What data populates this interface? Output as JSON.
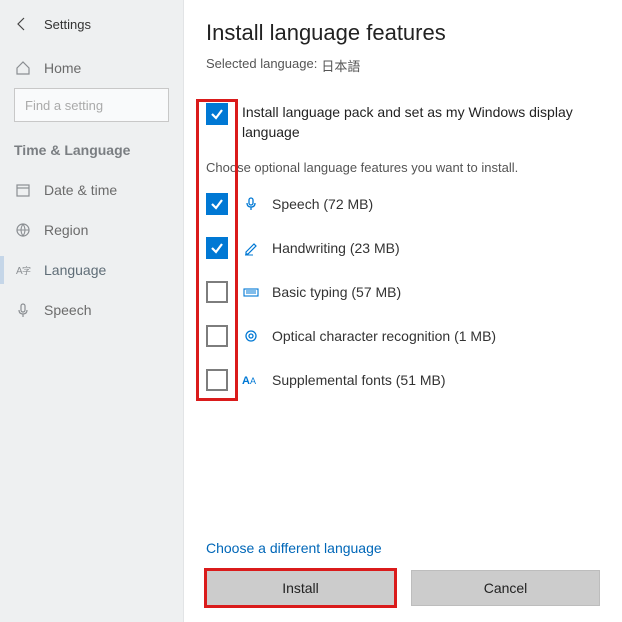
{
  "sidebar": {
    "app_title": "Settings",
    "home_label": "Home",
    "search_placeholder": "Find a setting",
    "category_label": "Time & Language",
    "items": [
      {
        "label": "Date & time"
      },
      {
        "label": "Region"
      },
      {
        "label": "Language"
      },
      {
        "label": "Speech"
      }
    ]
  },
  "main": {
    "title": "Install language features",
    "selected_label": "Selected language:",
    "selected_value": "日本語",
    "primary_option": "Install language pack and set as my Windows display language",
    "optional_desc": "Choose optional language features you want to install.",
    "features": [
      {
        "label": "Speech (72 MB)"
      },
      {
        "label": "Handwriting (23 MB)"
      },
      {
        "label": "Basic typing (57 MB)"
      },
      {
        "label": "Optical character recognition (1 MB)"
      },
      {
        "label": "Supplemental fonts (51 MB)"
      }
    ],
    "link_text": "Choose a different language",
    "install_btn": "Install",
    "cancel_btn": "Cancel"
  }
}
